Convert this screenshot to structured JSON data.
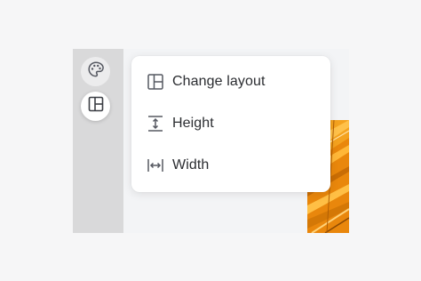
{
  "toolbar": {
    "buttons": [
      {
        "icon": "palette-icon"
      },
      {
        "icon": "layout-icon",
        "active": true
      }
    ]
  },
  "menu": {
    "items": [
      {
        "label": "Change layout",
        "icon": "layout-icon"
      },
      {
        "label": "Height",
        "icon": "height-icon"
      },
      {
        "label": "Width",
        "icon": "width-icon"
      }
    ]
  },
  "colors": {
    "icon": "#555861",
    "text": "#2b2d31",
    "sidebar": "#d9d9da",
    "photo_accent": "#f0960f"
  }
}
